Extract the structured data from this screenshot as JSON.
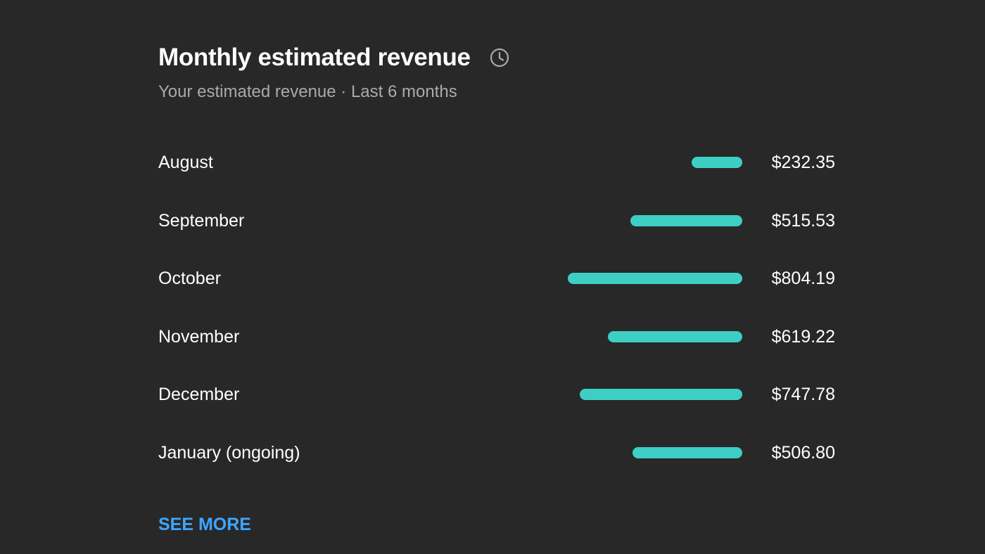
{
  "header": {
    "title": "Monthly estimated revenue",
    "info_icon": "clock-icon",
    "subtitle": "Your estimated revenue · Last 6 months"
  },
  "accent_color": "#3ecfc4",
  "link_color": "#3ea6ff",
  "chart_data": {
    "type": "bar",
    "orientation": "horizontal",
    "categories": [
      "August",
      "September",
      "October",
      "November",
      "December",
      "January (ongoing)"
    ],
    "values": [
      232.35,
      515.53,
      804.19,
      619.22,
      747.78,
      506.8
    ],
    "value_labels": [
      "$232.35",
      "$515.53",
      "$804.19",
      "$619.22",
      "$747.78",
      "$506.80"
    ]
  },
  "footer": {
    "see_more_label": "SEE MORE"
  }
}
